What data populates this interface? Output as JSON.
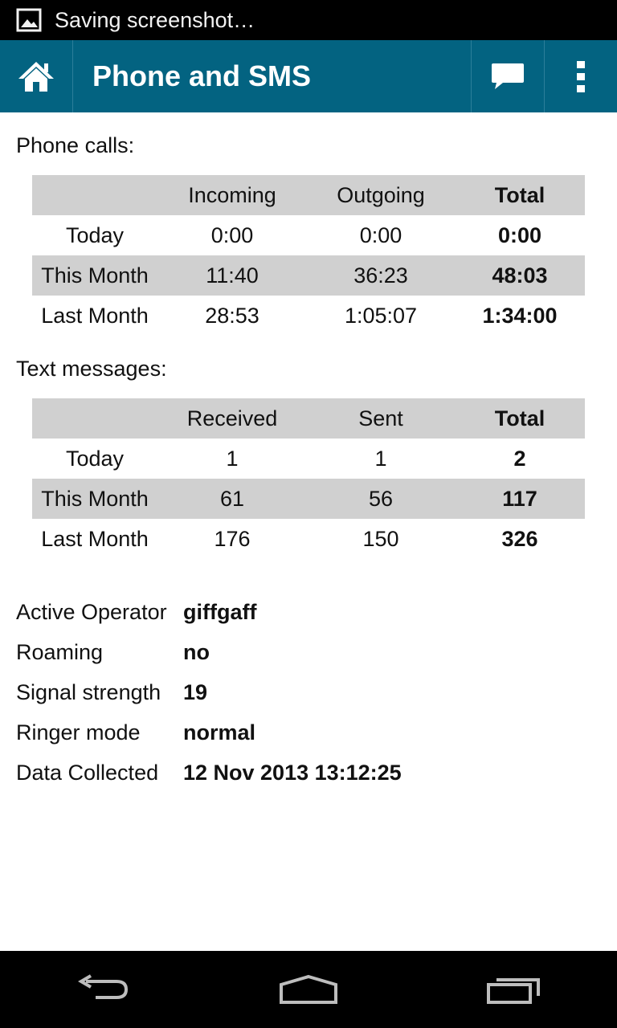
{
  "status_bar": {
    "icon": "image-icon",
    "text": "Saving screenshot…"
  },
  "action_bar": {
    "title": "Phone and SMS",
    "icons": [
      "home-icon",
      "message-icon",
      "overflow-menu-icon"
    ],
    "background": "#036381"
  },
  "phone_calls": {
    "title": "Phone calls:",
    "headers": [
      "",
      "Incoming",
      "Outgoing",
      "Total"
    ],
    "rows": [
      {
        "label": "Today",
        "incoming": "0:00",
        "outgoing": "0:00",
        "total": "0:00"
      },
      {
        "label": "This Month",
        "incoming": "11:40",
        "outgoing": "36:23",
        "total": "48:03"
      },
      {
        "label": "Last Month",
        "incoming": "28:53",
        "outgoing": "1:05:07",
        "total": "1:34:00"
      }
    ]
  },
  "text_messages": {
    "title": "Text messages:",
    "headers": [
      "",
      "Received",
      "Sent",
      "Total"
    ],
    "rows": [
      {
        "label": "Today",
        "received": "1",
        "sent": "1",
        "total": "2"
      },
      {
        "label": "This Month",
        "received": "61",
        "sent": "56",
        "total": "117"
      },
      {
        "label": "Last Month",
        "received": "176",
        "sent": "150",
        "total": "326"
      }
    ]
  },
  "info": [
    {
      "label": "Active Operator",
      "value": "giffgaff"
    },
    {
      "label": "Roaming",
      "value": "no"
    },
    {
      "label": "Signal strength",
      "value": "19"
    },
    {
      "label": "Ringer mode",
      "value": "normal"
    },
    {
      "label": "Data Collected",
      "value": "12 Nov 2013 13:12:25"
    }
  ],
  "nav_bar": {
    "icons": [
      "back-icon",
      "home-nav-icon",
      "recent-apps-icon"
    ]
  }
}
